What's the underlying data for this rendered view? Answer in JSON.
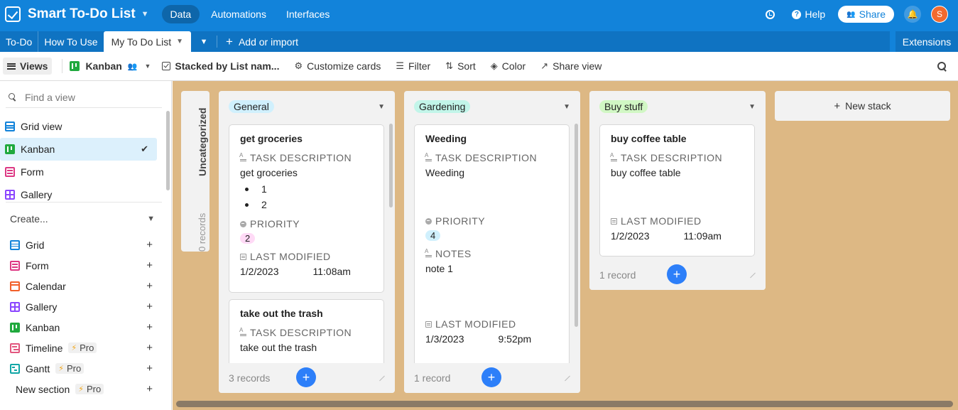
{
  "app": {
    "title": "Smart To-Do List",
    "nav": [
      "Data",
      "Automations",
      "Interfaces"
    ],
    "active_nav": "Data"
  },
  "header": {
    "help": "Help",
    "share": "Share",
    "avatar_initial": "S"
  },
  "tabs": {
    "items": [
      "To-Do",
      "How To Use",
      "My To Do List"
    ],
    "add_import": "Add or import",
    "extensions": "Extensions"
  },
  "toolbar": {
    "views": "Views",
    "view_name": "Kanban",
    "stacked": "Stacked by List nam...",
    "customize": "Customize cards",
    "filter": "Filter",
    "sort": "Sort",
    "color": "Color",
    "share_view": "Share view"
  },
  "sidebar": {
    "find_placeholder": "Find a view",
    "views": [
      {
        "label": "Grid view",
        "icon": "grid-icon"
      },
      {
        "label": "Kanban",
        "icon": "kanban-icon",
        "active": true
      },
      {
        "label": "Form",
        "icon": "form-icon"
      },
      {
        "label": "Gallery",
        "icon": "gallery-icon"
      }
    ],
    "create_label": "Create...",
    "create": [
      {
        "label": "Grid"
      },
      {
        "label": "Form"
      },
      {
        "label": "Calendar"
      },
      {
        "label": "Gallery"
      },
      {
        "label": "Kanban"
      },
      {
        "label": "Timeline",
        "pro": "Pro"
      },
      {
        "label": "Gantt",
        "pro": "Pro"
      },
      {
        "label": "New section",
        "pro": "Pro"
      }
    ]
  },
  "board": {
    "uncategorized": {
      "title": "Uncategorized",
      "count": "0 records"
    },
    "stacks": [
      {
        "label": "General",
        "color": "#d0f0fd",
        "count": "3 records",
        "cards": [
          {
            "title": "get groceries",
            "fields": [
              {
                "label": "TASK DESCRIPTION",
                "value": "get groceries",
                "bullets": [
                  "1",
                  "2"
                ]
              },
              {
                "label": "PRIORITY",
                "pill": "2",
                "pill_color": "#ffdaf6"
              },
              {
                "label": "LAST MODIFIED",
                "date": "1/2/2023",
                "time": "11:08am"
              }
            ]
          },
          {
            "title": "take out the trash",
            "fields": [
              {
                "label": "TASK DESCRIPTION",
                "value": "take out the trash"
              }
            ]
          }
        ]
      },
      {
        "label": "Gardening",
        "color": "#c2f5e9",
        "count": "1 record",
        "cards": [
          {
            "title": "Weeding",
            "fields": [
              {
                "label": "TASK DESCRIPTION",
                "value": "Weeding"
              },
              {
                "label": "PRIORITY",
                "pill": "4",
                "pill_color": "#d0f0fd"
              },
              {
                "label": "NOTES",
                "value": "note 1"
              },
              {
                "label": "LAST MODIFIED",
                "date": "1/3/2023",
                "time": "9:52pm"
              }
            ]
          }
        ]
      },
      {
        "label": "Buy stuff",
        "color": "#d1f7c4",
        "count": "1 record",
        "cards": [
          {
            "title": "buy coffee table",
            "fields": [
              {
                "label": "TASK DESCRIPTION",
                "value": "buy coffee table"
              },
              {
                "label": "LAST MODIFIED",
                "date": "1/2/2023",
                "time": "11:09am"
              }
            ]
          }
        ]
      }
    ],
    "new_stack": "New stack"
  }
}
